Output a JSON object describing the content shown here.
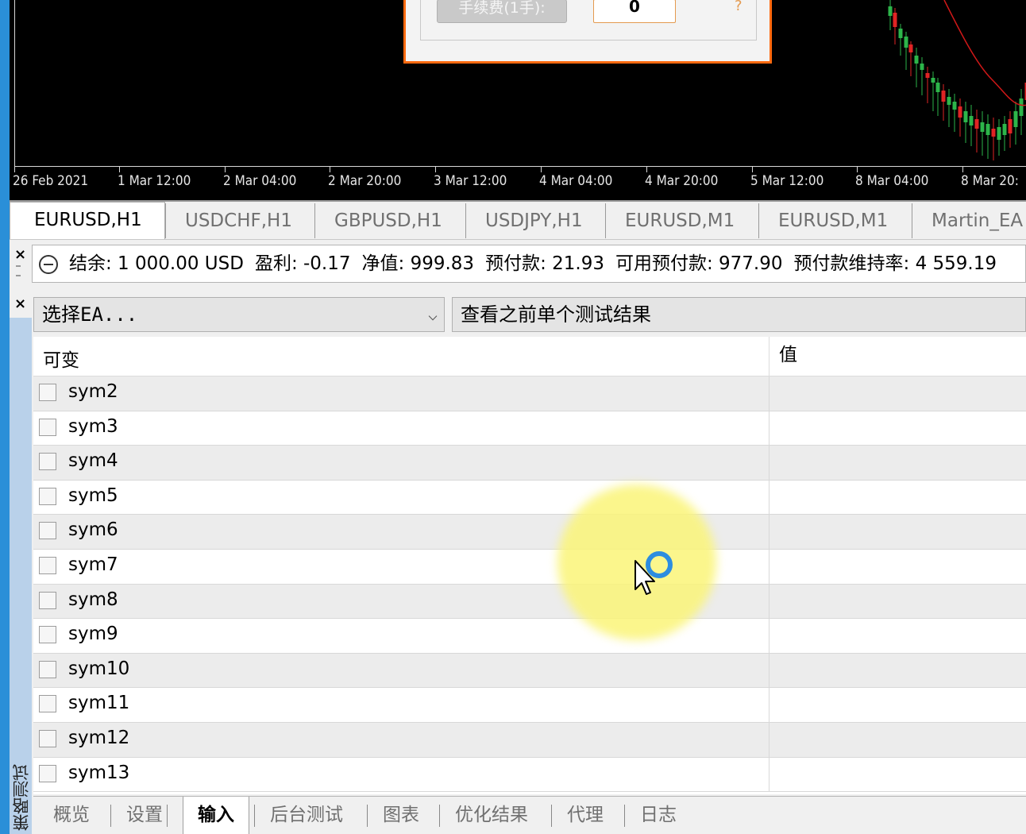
{
  "chart": {
    "time_labels": [
      "26 Feb 2021",
      "1 Mar 12:00",
      "2 Mar 04:00",
      "2 Mar 20:00",
      "3 Mar 12:00",
      "4 Mar 04:00",
      "4 Mar 20:00",
      "5 Mar 12:00",
      "8 Mar 04:00",
      "8 Mar 20:"
    ],
    "colors": {
      "background": "#000000",
      "bull": "#2db54a",
      "bear": "#e02424",
      "ma": "#d01818",
      "axis_text": "#e6e6e6"
    }
  },
  "dialog": {
    "fee_label": "手续费(1手):",
    "fee_value": "0",
    "help": "?"
  },
  "chart_tabs": [
    "EURUSD,H1",
    "USDCHF,H1",
    "GBPUSD,H1",
    "USDJPY,H1",
    "EURUSD,M1",
    "EURUSD,M1",
    "Martin_EA"
  ],
  "account": {
    "close": "×",
    "balance": "结余: 1 000.00 USD",
    "profit": "盈利: -0.17",
    "equity": "净值: 999.83",
    "margin": "预付款: 21.93",
    "free_margin": "可用预付款: 977.90",
    "margin_level": "预付款维持率: 4 559.19"
  },
  "tester": {
    "title": "策略测试",
    "close": "×",
    "ea_select": "选择EA...",
    "ea_chevron": "⌵",
    "prev_results": "查看之前单个测试结果",
    "header_variable": "可变",
    "header_value": "值",
    "params": [
      "sym2",
      "sym3",
      "sym4",
      "sym5",
      "sym6",
      "sym7",
      "sym8",
      "sym9",
      "sym10",
      "sym11",
      "sym12",
      "sym13"
    ],
    "bottom_tabs": [
      "概览",
      "设置",
      "输入",
      "后台测试",
      "图表",
      "优化结果",
      "代理",
      "日志"
    ],
    "active_tab": "输入"
  }
}
